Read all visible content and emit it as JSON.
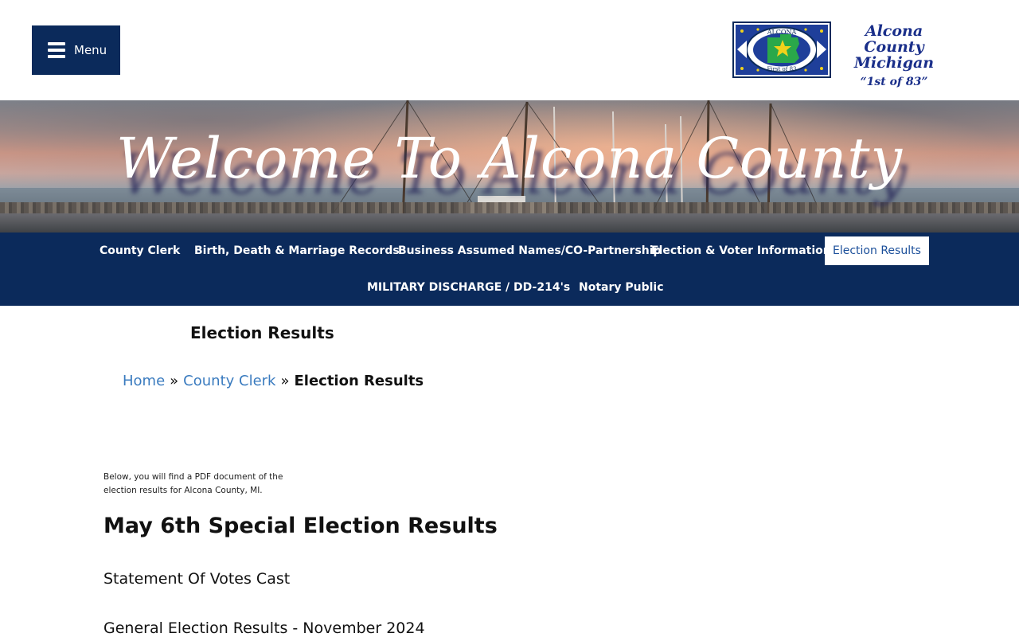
{
  "header": {
    "menu_label": "Menu",
    "logo": {
      "seal_top_text": "ALCONA",
      "seal_bottom_text": "First of 83",
      "line1": "Alcona County",
      "line2": "Michigan",
      "line3": "“1st of 83”"
    }
  },
  "banner": {
    "title": "Welcome To Alcona County"
  },
  "nav": {
    "items": [
      {
        "label": "County Clerk"
      },
      {
        "label": "Birth, Death & Marriage Records"
      },
      {
        "label": "Business Assumed Names/CO-Partnership"
      },
      {
        "label": "Election & Voter Information"
      },
      {
        "label": "Election Results",
        "active": true
      },
      {
        "label": "MILITARY DISCHARGE / DD-214's"
      },
      {
        "label": "Notary Public"
      }
    ]
  },
  "page": {
    "title": "Election Results"
  },
  "breadcrumb": {
    "home": "Home",
    "sep": "»",
    "parent": "County Clerk",
    "current": "Election Results"
  },
  "content": {
    "intro": "Below, you will find a PDF document of the election results for Alcona County, MI.",
    "section_title": "May 6th Special Election Results",
    "links": [
      "Statement Of Votes Cast",
      "General Election Results - November 2024"
    ]
  },
  "colors": {
    "navy": "#0b2a5b",
    "link_blue": "#3a7bbf",
    "logo_blue": "#1a2f8a"
  }
}
